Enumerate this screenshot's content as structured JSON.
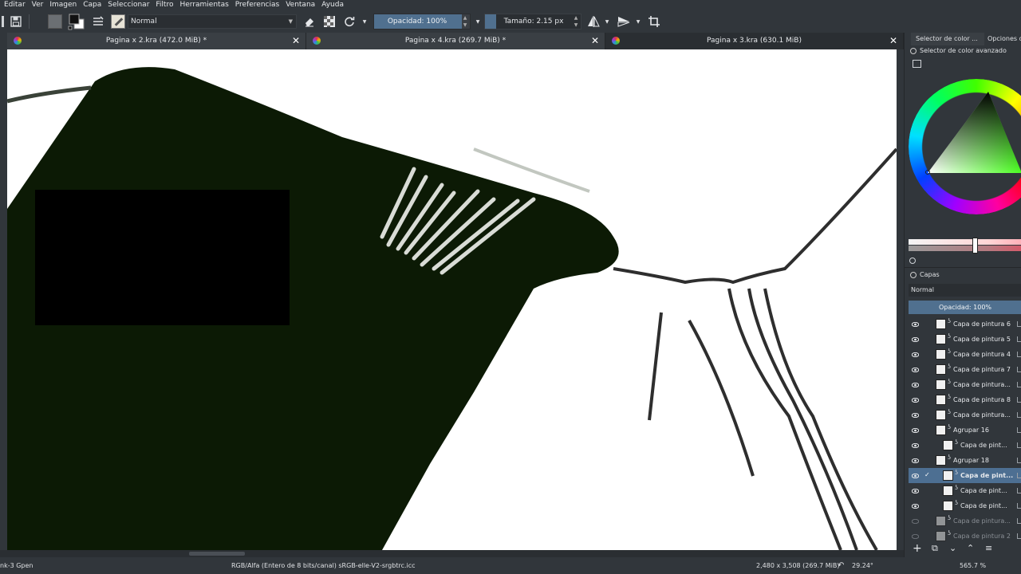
{
  "menu": [
    "Editar",
    "Ver",
    "Imagen",
    "Capa",
    "Seleccionar",
    "Filtro",
    "Herramientas",
    "Preferencias",
    "Ventana",
    "Ayuda"
  ],
  "toolbar": {
    "blend_mode": "Normal",
    "opacity_label": "Opacidad: 100%",
    "opacity_value": 1.0,
    "size_label": "Tamaño: 2.15 px"
  },
  "tabs": [
    {
      "title": "Pagina x 2.kra (472.0 MiB) *"
    },
    {
      "title": "Pagina x 4.kra (269.7 MiB) *"
    },
    {
      "title": "Pagina x 3.kra (630.1 MiB)"
    }
  ],
  "dock": {
    "tab1": "Selector de color ...",
    "tab2": "Opciones de",
    "color_selector_title": "Selector de color avanzado",
    "layers_title": "Capas",
    "layers_mode": "Normal",
    "layers_opacity": "Opacidad:  100%"
  },
  "layers": [
    {
      "name": "Capa de pintura 6",
      "visible": true,
      "indent": 0,
      "selected": false,
      "dim": false
    },
    {
      "name": "Capa de pintura 5",
      "visible": true,
      "indent": 0,
      "selected": false,
      "dim": false
    },
    {
      "name": "Capa de pintura 4",
      "visible": true,
      "indent": 0,
      "selected": false,
      "dim": false
    },
    {
      "name": "Capa de pintura 7",
      "visible": true,
      "indent": 0,
      "selected": false,
      "dim": false
    },
    {
      "name": "Capa de pintura...",
      "visible": true,
      "indent": 0,
      "selected": false,
      "dim": false
    },
    {
      "name": "Capa de pintura 8",
      "visible": true,
      "indent": 0,
      "selected": false,
      "dim": false
    },
    {
      "name": "Capa de pintura...",
      "visible": true,
      "indent": 0,
      "selected": false,
      "dim": false
    },
    {
      "name": "Agrupar 16",
      "visible": true,
      "indent": 0,
      "selected": false,
      "dim": false
    },
    {
      "name": "Capa de pint...",
      "visible": true,
      "indent": 1,
      "selected": false,
      "dim": false
    },
    {
      "name": "Agrupar 18",
      "visible": true,
      "indent": 0,
      "selected": false,
      "dim": false
    },
    {
      "name": "Capa de pint...",
      "visible": true,
      "indent": 1,
      "selected": true,
      "dim": false
    },
    {
      "name": "Capa de pint...",
      "visible": true,
      "indent": 1,
      "selected": false,
      "dim": false
    },
    {
      "name": "Capa de pint...",
      "visible": true,
      "indent": 1,
      "selected": false,
      "dim": false
    },
    {
      "name": "Capa de pintura...",
      "visible": false,
      "indent": 0,
      "selected": false,
      "dim": true
    },
    {
      "name": "Capa de pintura 2",
      "visible": false,
      "indent": 0,
      "selected": false,
      "dim": true
    }
  ],
  "status": {
    "brush": "nk-3 Gpen",
    "color_space": "RGB/Alfa (Entero de 8 bits/canal)  sRGB-elle-V2-srgbtrc.icc",
    "dimensions": "2,480 x 3,508 (269.7 MiB)",
    "rotation": "29.24°",
    "zoom": "565.7 %"
  },
  "colors": {
    "accent": "#50708f",
    "ink": "#0c1a05",
    "ui_bg": "#31363b"
  },
  "icons": [
    "save-icon",
    "eraser-icon",
    "alpha-lock-icon",
    "reload-icon",
    "mirror-horizontal-icon",
    "mirror-vertical-icon",
    "crop-icon"
  ]
}
